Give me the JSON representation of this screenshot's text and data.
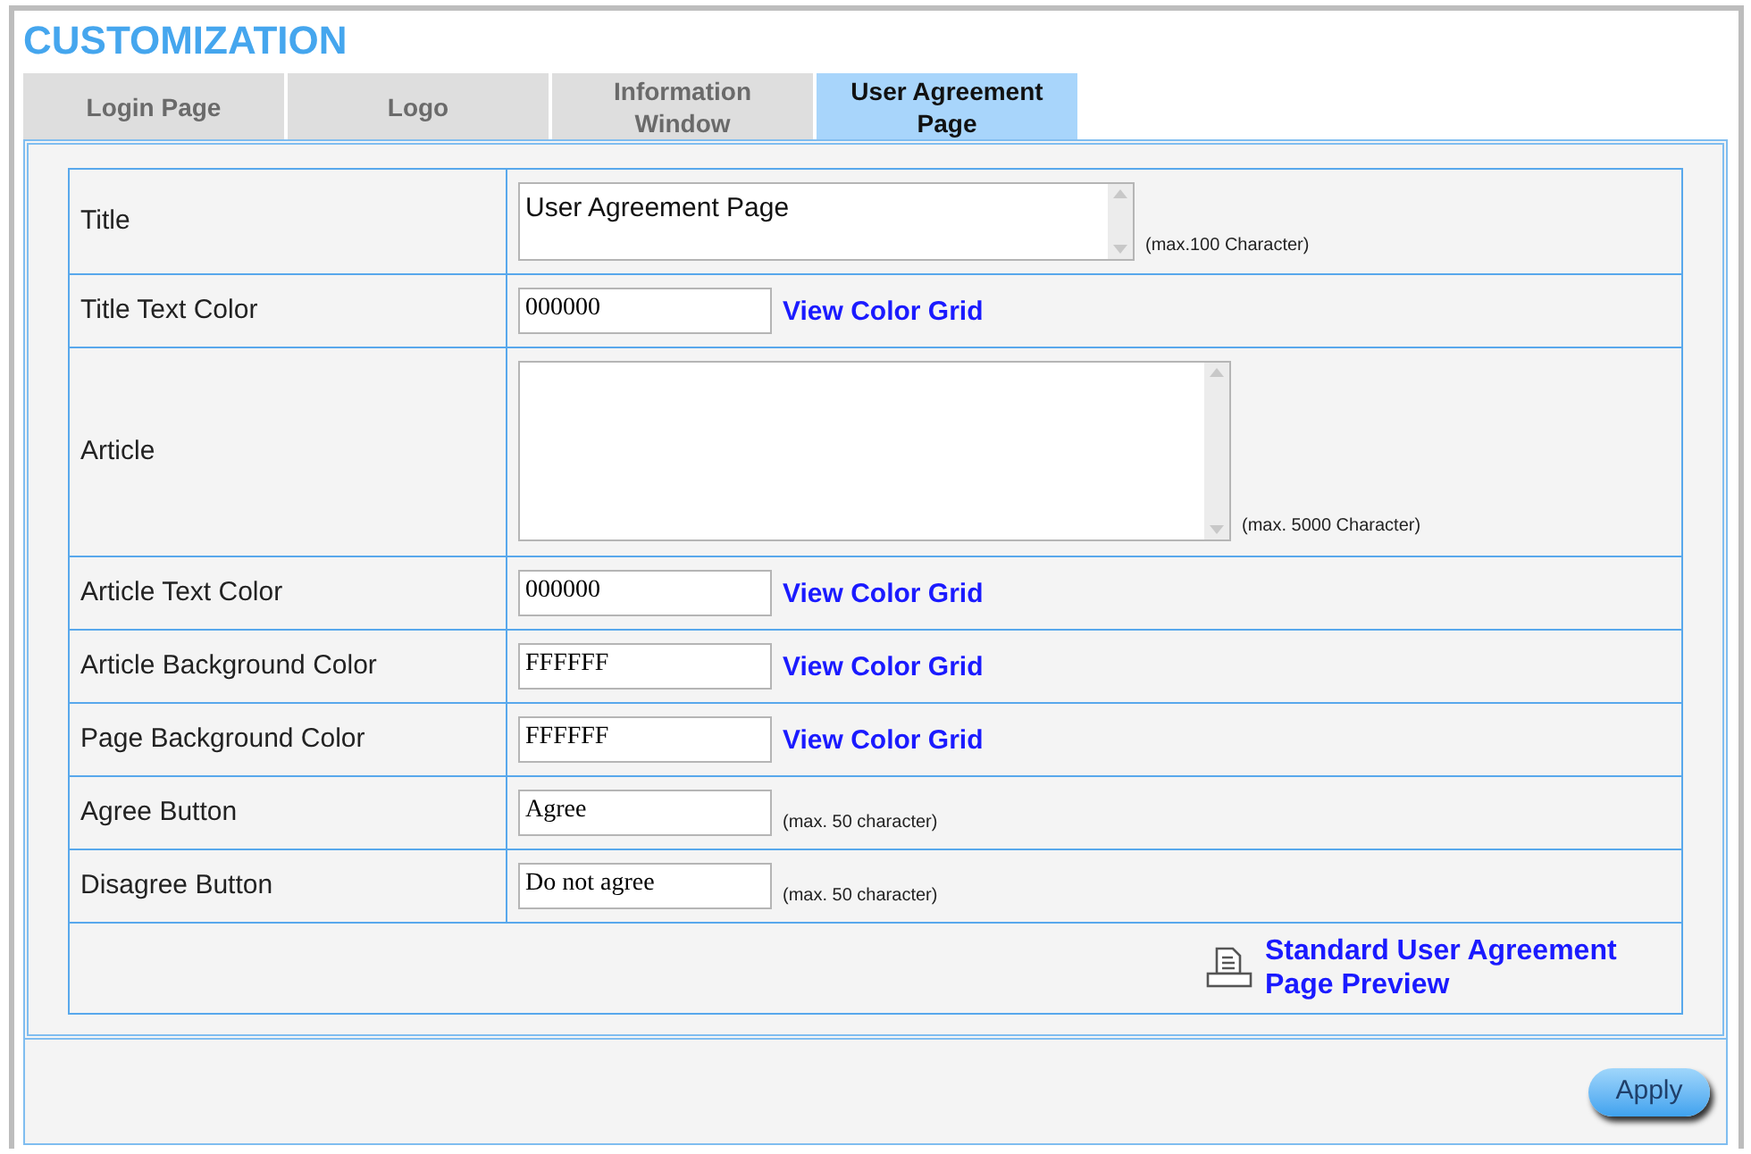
{
  "title": "CUSTOMIZATION",
  "tabs": [
    {
      "label": "Login Page",
      "selected": false
    },
    {
      "label": "Logo",
      "selected": false
    },
    {
      "label": "Information Window",
      "selected": false
    },
    {
      "label": "User Agreement Page",
      "selected": true
    }
  ],
  "rows": [
    {
      "kind": "textbox",
      "label": "Title",
      "value": "User Agreement Page",
      "hint": "(max.100 Character)"
    },
    {
      "kind": "color",
      "label": "Title Text Color",
      "value": "000000",
      "link": "View Color Grid"
    },
    {
      "kind": "textarea",
      "label": "Article",
      "hint": "(max. 5000 Character)"
    },
    {
      "kind": "color",
      "label": "Article Text Color",
      "value": "000000",
      "link": "View Color Grid"
    },
    {
      "kind": "color",
      "label": "Article Background Color",
      "value": "FFFFFF",
      "link": "View Color Grid"
    },
    {
      "kind": "color",
      "label": "Page Background Color",
      "value": "FFFFFF",
      "link": "View Color Grid"
    },
    {
      "kind": "text",
      "label": "Agree Button",
      "value": "Agree",
      "hint": "(max. 50 character)"
    },
    {
      "kind": "text",
      "label": "Disagree Button",
      "value": "Do not agree",
      "hint": "(max. 50 character)"
    }
  ],
  "preview_link": "Standard User Agreement Page Preview",
  "apply_button": "Apply"
}
